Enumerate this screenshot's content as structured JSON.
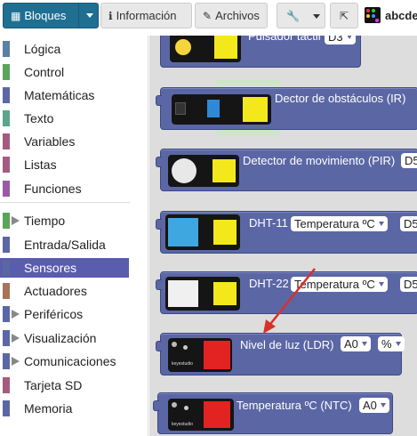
{
  "toolbar": {
    "blocks_label": "Bloques",
    "info_label": "Información",
    "files_label": "Archivos",
    "project_name": "abcde"
  },
  "sidebar": {
    "items": [
      {
        "label": "Lógica",
        "color": "#5b80a5"
      },
      {
        "label": "Control",
        "color": "#5ba55b"
      },
      {
        "label": "Matemáticas",
        "color": "#5b67a5"
      },
      {
        "label": "Texto",
        "color": "#5ba58c"
      },
      {
        "label": "Variables",
        "color": "#a55b80"
      },
      {
        "label": "Listas",
        "color": "#a55b80"
      },
      {
        "label": "Funciones",
        "color": "#995ba5"
      },
      {
        "label": "Tiempo",
        "color": "#5ba55b",
        "expandable": true
      },
      {
        "label": "Entrada/Salida",
        "color": "#5b67a5"
      },
      {
        "label": "Sensores",
        "color": "#5b67a5",
        "selected": true
      },
      {
        "label": "Actuadores",
        "color": "#a5745b"
      },
      {
        "label": "Periféricos",
        "color": "#5b67a5",
        "expandable": true
      },
      {
        "label": "Visualización",
        "color": "#5b67a5",
        "expandable": true
      },
      {
        "label": "Comunicaciones",
        "color": "#5b67a5",
        "expandable": true
      },
      {
        "label": "Tarjeta SD",
        "color": "#a55b80"
      },
      {
        "label": "Memoria",
        "color": "#5b67a5"
      }
    ]
  },
  "blocks": {
    "touch": {
      "label": "Pulsador táctil",
      "pin": "D3"
    },
    "ir": {
      "label": "Dector de obstáculos (IR)"
    },
    "pir": {
      "label": "Detector de movimiento (PIR)",
      "pin": "D5"
    },
    "dht11": {
      "label": "DHT-11",
      "measure": "Temperatura ºC",
      "pin": "D5"
    },
    "dht22": {
      "label": "DHT-22",
      "measure": "Temperatura ºC",
      "pin": "D5"
    },
    "ldr": {
      "label": "Nivel de luz (LDR)",
      "pin": "A0",
      "unit": "%",
      "brand": "keyestudio"
    },
    "ntc": {
      "label": "Temperatura ºC (NTC)",
      "pin": "A0",
      "brand": "keyestudio"
    }
  },
  "colors": {
    "primary": "#1f6f93",
    "sensor_block": "#5b67a5",
    "annotation_arrow": "#d9302a"
  }
}
